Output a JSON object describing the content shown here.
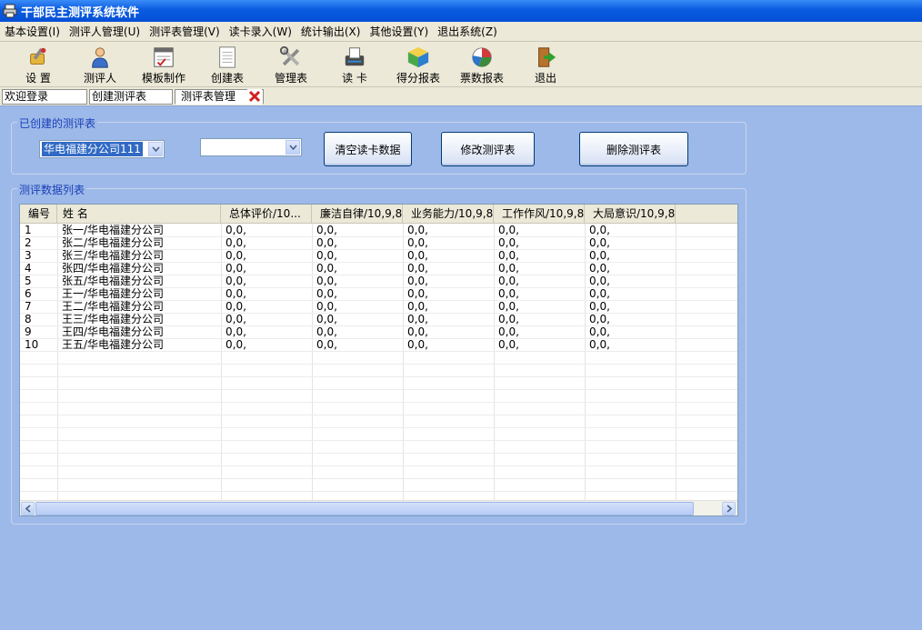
{
  "window": {
    "title": "干部民主测评系统软件"
  },
  "menu": [
    "基本设置(I)",
    "测评人管理(U)",
    "测评表管理(V)",
    "读卡录入(W)",
    "统计输出(X)",
    "其他设置(Y)",
    "退出系统(Z)"
  ],
  "toolbar": [
    {
      "label": "设 置",
      "icon": "settings-tools-icon"
    },
    {
      "label": "测评人",
      "icon": "person-icon"
    },
    {
      "label": "模板制作",
      "icon": "template-icon"
    },
    {
      "label": "创建表",
      "icon": "create-table-icon"
    },
    {
      "label": "管理表",
      "icon": "manage-tools-icon"
    },
    {
      "label": "读 卡",
      "icon": "card-reader-icon"
    },
    {
      "label": "得分报表",
      "icon": "score-report-icon"
    },
    {
      "label": "票数报表",
      "icon": "vote-report-icon"
    },
    {
      "label": "退出",
      "icon": "exit-door-icon"
    }
  ],
  "tabs": [
    "欢迎登录",
    "创建测评表",
    "测评表管理"
  ],
  "created_group": {
    "title": "已创建的测评表",
    "select_value": "华电福建分公司111",
    "select2_value": "",
    "buttons": {
      "clear": "清空读卡数据",
      "modify": "修改测评表",
      "delete": "删除测评表"
    }
  },
  "data_group": {
    "title": "测评数据列表",
    "columns": [
      "编号",
      "姓  名",
      "总体评价/10...",
      "廉洁自律/10,9,8",
      "业务能力/10,9,8",
      "工作作风/10,9,8",
      "大局意识/10,9,8"
    ],
    "rows": [
      [
        "1",
        "张一/华电福建分公司",
        "0,0,",
        "0,0,",
        "0,0,",
        "0,0,",
        "0,0,"
      ],
      [
        "2",
        "张二/华电福建分公司",
        "0,0,",
        "0,0,",
        "0,0,",
        "0,0,",
        "0,0,"
      ],
      [
        "3",
        "张三/华电福建分公司",
        "0,0,",
        "0,0,",
        "0,0,",
        "0,0,",
        "0,0,"
      ],
      [
        "4",
        "张四/华电福建分公司",
        "0,0,",
        "0,0,",
        "0,0,",
        "0,0,",
        "0,0,"
      ],
      [
        "5",
        "张五/华电福建分公司",
        "0,0,",
        "0,0,",
        "0,0,",
        "0,0,",
        "0,0,"
      ],
      [
        "6",
        "王一/华电福建分公司",
        "0,0,",
        "0,0,",
        "0,0,",
        "0,0,",
        "0,0,"
      ],
      [
        "7",
        "王二/华电福建分公司",
        "0,0,",
        "0,0,",
        "0,0,",
        "0,0,",
        "0,0,"
      ],
      [
        "8",
        "王三/华电福建分公司",
        "0,0,",
        "0,0,",
        "0,0,",
        "0,0,",
        "0,0,"
      ],
      [
        "9",
        "王四/华电福建分公司",
        "0,0,",
        "0,0,",
        "0,0,",
        "0,0,",
        "0,0,"
      ],
      [
        "10",
        "王五/华电福建分公司",
        "0,0,",
        "0,0,",
        "0,0,",
        "0,0,",
        "0,0,"
      ]
    ]
  },
  "colors": {
    "background": "#9db9e9",
    "group_title": "#1a3fb7",
    "titlebar": "#0a5be0",
    "selection": "#316ac5"
  }
}
